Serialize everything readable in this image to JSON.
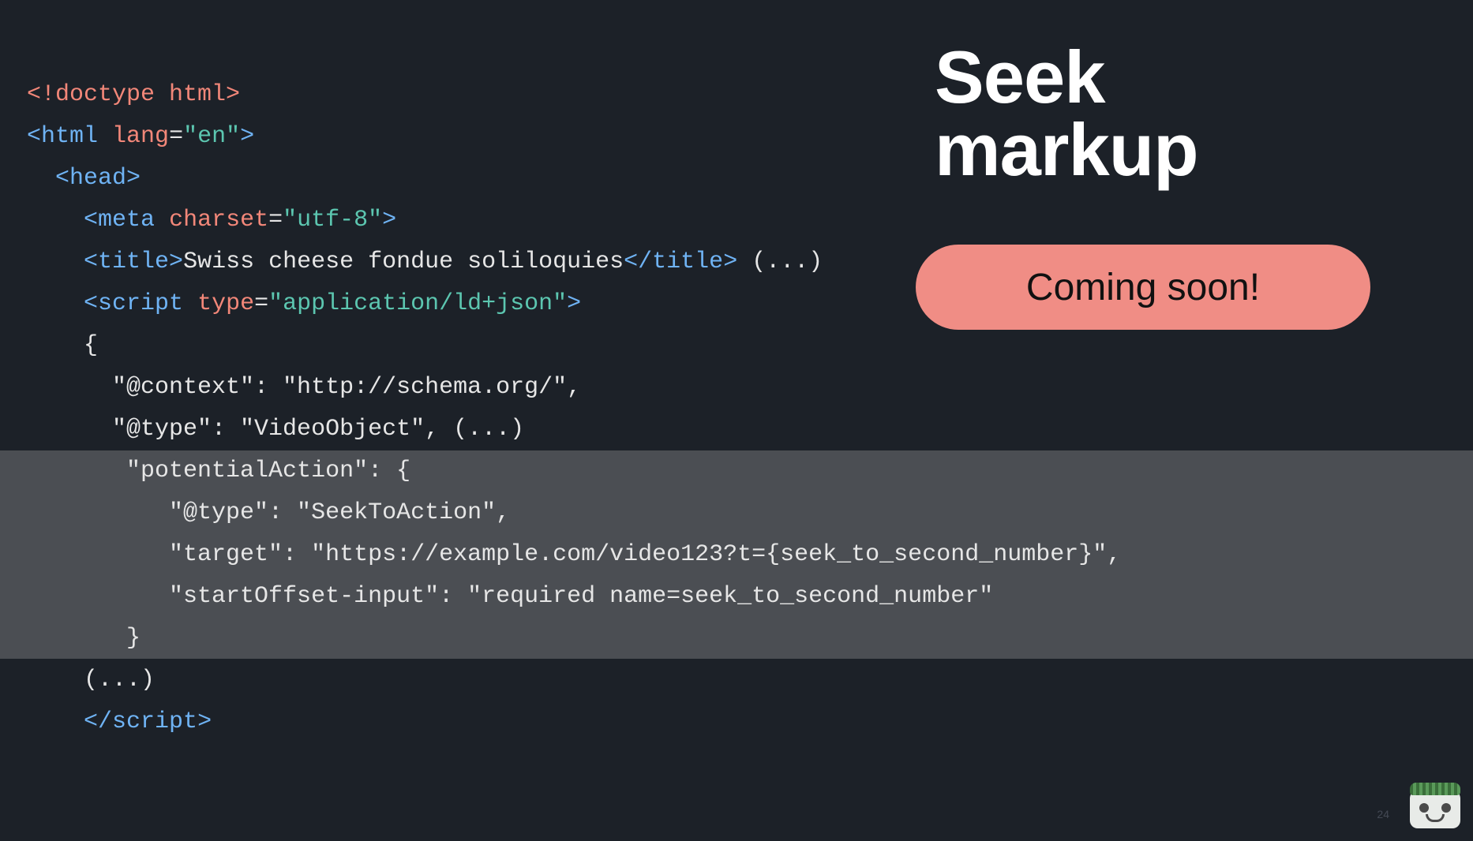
{
  "headline_l1": "Seek",
  "headline_l2": "markup",
  "pill_text": "Coming soon!",
  "page_number": "24",
  "code": {
    "l1_doctype": "<!doctype html>",
    "l2_open": "<",
    "l2_tag": "html",
    "l2_sp": " ",
    "l2_attr": "lang",
    "l2_eq": "=",
    "l2_val": "\"en\"",
    "l2_close": ">",
    "l3_open": "<",
    "l3_tag": "head",
    "l3_close": ">",
    "l4_open": "<",
    "l4_tag": "meta",
    "l4_sp": " ",
    "l4_attr": "charset",
    "l4_eq": "=",
    "l4_val": "\"utf-8\"",
    "l4_close": ">",
    "l5_open": "<",
    "l5_tag": "title",
    "l5_close1": ">",
    "l5_text": "Swiss cheese fondue soliloquies",
    "l5_open2": "</",
    "l5_tag2": "title",
    "l5_close2": ">",
    "l5_tail": " (...)",
    "l6_open": "<",
    "l6_tag": "script",
    "l6_sp": " ",
    "l6_attr": "type",
    "l6_eq": "=",
    "l6_val": "\"application/ld+json\"",
    "l6_close": ">",
    "l7": "{",
    "l8": "  \"@context\": \"http://schema.org/\",",
    "l9": "  \"@type\": \"VideoObject\", (...)",
    "l10": "   \"potentialAction\": {",
    "l11": "      \"@type\": \"SeekToAction\",",
    "l12": "      \"target\": \"https://example.com/video123?t={seek_to_second_number}\",",
    "l13": "      \"startOffset-input\": \"required name=seek_to_second_number\"",
    "l14": "   }",
    "l15": "(...)",
    "l16_open": "</",
    "l16_tag": "script",
    "l16_close": ">"
  }
}
